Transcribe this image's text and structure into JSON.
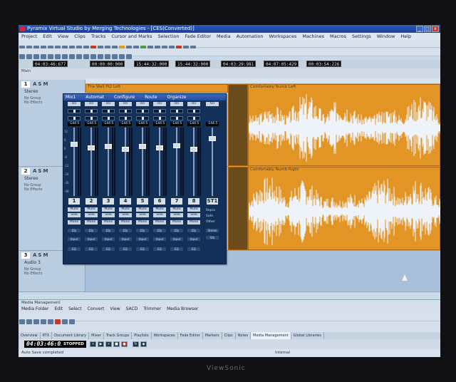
{
  "app": {
    "title": "Pyramix Virtual Studio by Merging Technologies - [CES(Converted)]",
    "brand": "ViewSonic"
  },
  "menu": [
    "Project",
    "Edit",
    "View",
    "Clips",
    "Tracks",
    "Cursor and Marks",
    "Selection",
    "Fade Editor",
    "Media",
    "Automation",
    "Workspaces",
    "Machines",
    "Macros",
    "Settings",
    "Window",
    "Help"
  ],
  "timecodes": {
    "main": "04:03:46:677",
    "t1": "00:00:00:000",
    "t2": "15:44:32:000",
    "t3": "15:44:32:000",
    "t4": "04:03:29:981",
    "t5": "04:07:05:429",
    "t6": "00:03:54:226"
  },
  "main_label": "Main",
  "tracks": [
    {
      "num": "1",
      "asm": "ASM",
      "name": "Stereo",
      "info1": "No Group",
      "info2": "No Effects",
      "clip": "The Wall Pt2 Left",
      "clip2": "Comfortably Numb Left"
    },
    {
      "num": "2",
      "asm": "ASM",
      "name": "Stereo",
      "info1": "No Group",
      "info2": "No Effects",
      "clip": "",
      "clip2": "Comfortably Numb Right"
    },
    {
      "num": "3",
      "asm": "ASM",
      "name": "Audio 3",
      "info1": "No Group",
      "info2": "No Effects",
      "clip": "",
      "clip2": ""
    }
  ],
  "mixer": {
    "title": "Mix1",
    "menu": [
      "Mix1",
      "Automat",
      "Configure",
      "Route",
      "Organize"
    ],
    "on": "On",
    "db": "-144.5",
    "mute": "Mute",
    "solo": "Solo",
    "mono": "Mono",
    "delay": "Dly",
    "input": "Input",
    "eq": "EQ",
    "strips": [
      "1",
      "2",
      "3",
      "4",
      "5",
      "6",
      "7",
      "8"
    ],
    "st": "ST1",
    "st_labels": [
      "Stereo",
      "Stk"
    ],
    "aux": [
      "Repro",
      "Safe",
      "Other"
    ],
    "scale": [
      "12",
      "6",
      "0",
      "-6",
      "-12",
      "-24",
      "-36",
      "-48"
    ]
  },
  "media": {
    "title": "Media Management",
    "menu": [
      "Media Folder",
      "Edit",
      "Select",
      "Convert",
      "View",
      "SACD",
      "Trimmer",
      "Media Browser"
    ]
  },
  "tabs": [
    "Overview",
    "RTX",
    "Document Library",
    "Mixer",
    "Track Groups",
    "Playlists",
    "Workspaces",
    "Fade Editor",
    "Markers",
    "Clips",
    "Notes",
    "Media Management",
    "Global Libraries"
  ],
  "transport": {
    "time": "04:03:46:01",
    "state": "STOPPED"
  },
  "status": {
    "left": "Auto Save completed",
    "right": "Internal"
  }
}
